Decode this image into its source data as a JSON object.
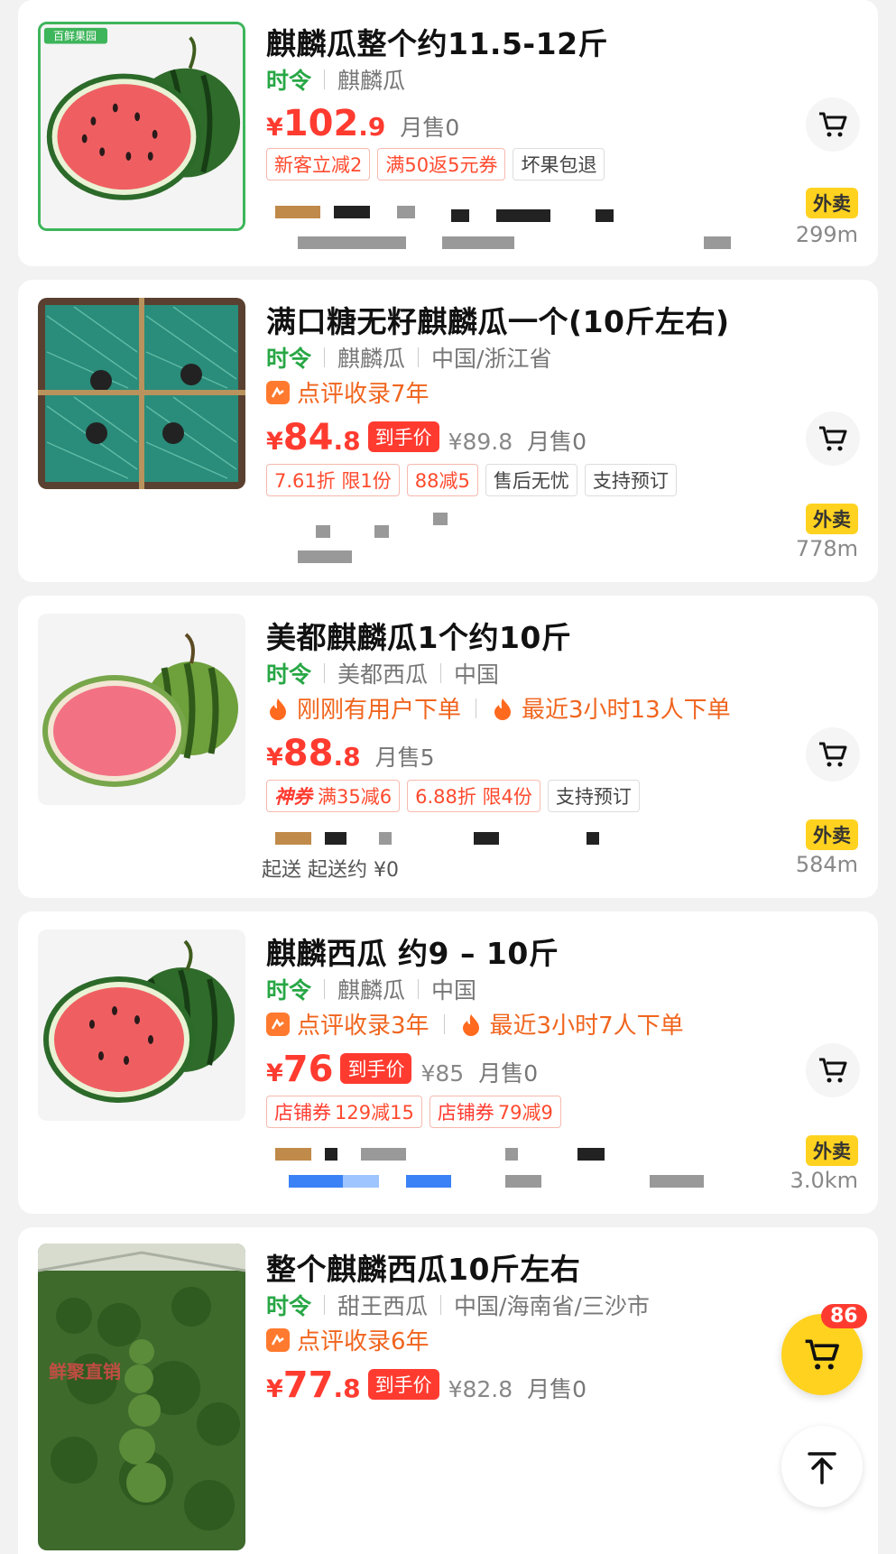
{
  "products": [
    {
      "title": "麒麟瓜整个约11.5-12斤",
      "season": "时令",
      "meta": [
        "麒麟瓜"
      ],
      "price_int": "102",
      "price_dec": ".9",
      "sold": "月售0",
      "tags": [
        "新客立减2",
        "满50返5元券",
        "坏果包退"
      ],
      "distance": "299m",
      "delivery_tag": "外卖",
      "brand_logo": "百鲜果园",
      "image_icon": "watermelon-half-icon"
    },
    {
      "title": "满口糖无籽麒麟瓜一个(10斤左右)",
      "season": "时令",
      "meta": [
        "麒麟瓜",
        "中国/浙江省"
      ],
      "highlights": [
        "点评收录7年"
      ],
      "price_int": "84",
      "price_dec": ".8",
      "hand_price": "到手价",
      "orig_price": "¥89.8",
      "sold": "月售0",
      "tags": [
        "7.61折 限1份",
        "88减5",
        "售后无忧",
        "支持预订"
      ],
      "distance": "778m",
      "delivery_tag": "外卖",
      "image_icon": "watermelon-box-icon"
    },
    {
      "title": "美都麒麟瓜1个约10斤",
      "season": "时令",
      "meta": [
        "美都西瓜",
        "中国"
      ],
      "highlights": [
        "刚刚有用户下单",
        "最近3小时13人下单"
      ],
      "price_int": "88",
      "price_dec": ".8",
      "sold": "月售5",
      "tags": [
        "神券",
        "满35减6",
        "6.88折 限4份",
        "支持预订"
      ],
      "distance": "584m",
      "delivery_tag": "外卖",
      "min_order_text": "起送 起送约 ¥0",
      "image_icon": "watermelon-whole-icon"
    },
    {
      "title": "麒麟西瓜 约9 – 10斤",
      "season": "时令",
      "meta": [
        "麒麟瓜",
        "中国"
      ],
      "highlights": [
        "点评收录3年",
        "最近3小时7人下单"
      ],
      "price_int": "76",
      "price_dec": "",
      "hand_price": "到手价",
      "orig_price": "¥85",
      "sold": "月售0",
      "tags": [
        "店铺券",
        "129减15",
        "店铺券",
        "79减9"
      ],
      "distance": "3.0km",
      "delivery_tag": "外卖",
      "image_icon": "watermelon-half-icon"
    },
    {
      "title": "整个麒麟西瓜10斤左右",
      "season": "时令",
      "meta": [
        "甜王西瓜",
        "中国/海南省/三沙市"
      ],
      "highlights": [
        "点评收录6年"
      ],
      "price_int": "77",
      "price_dec": ".8",
      "hand_price": "到手价",
      "orig_price": "¥82.8",
      "sold": "月售0",
      "watermark": "鲜聚直销",
      "image_icon": "watermelon-field-icon"
    }
  ],
  "currency": "¥",
  "cart": {
    "count": "86",
    "icon": "cart-icon"
  },
  "back_to_top_icon": "arrow-up-icon",
  "colors": {
    "price": "#ff3b30",
    "season": "#28a745",
    "highlight": "#f0651e",
    "yellow": "#ffd21f"
  }
}
